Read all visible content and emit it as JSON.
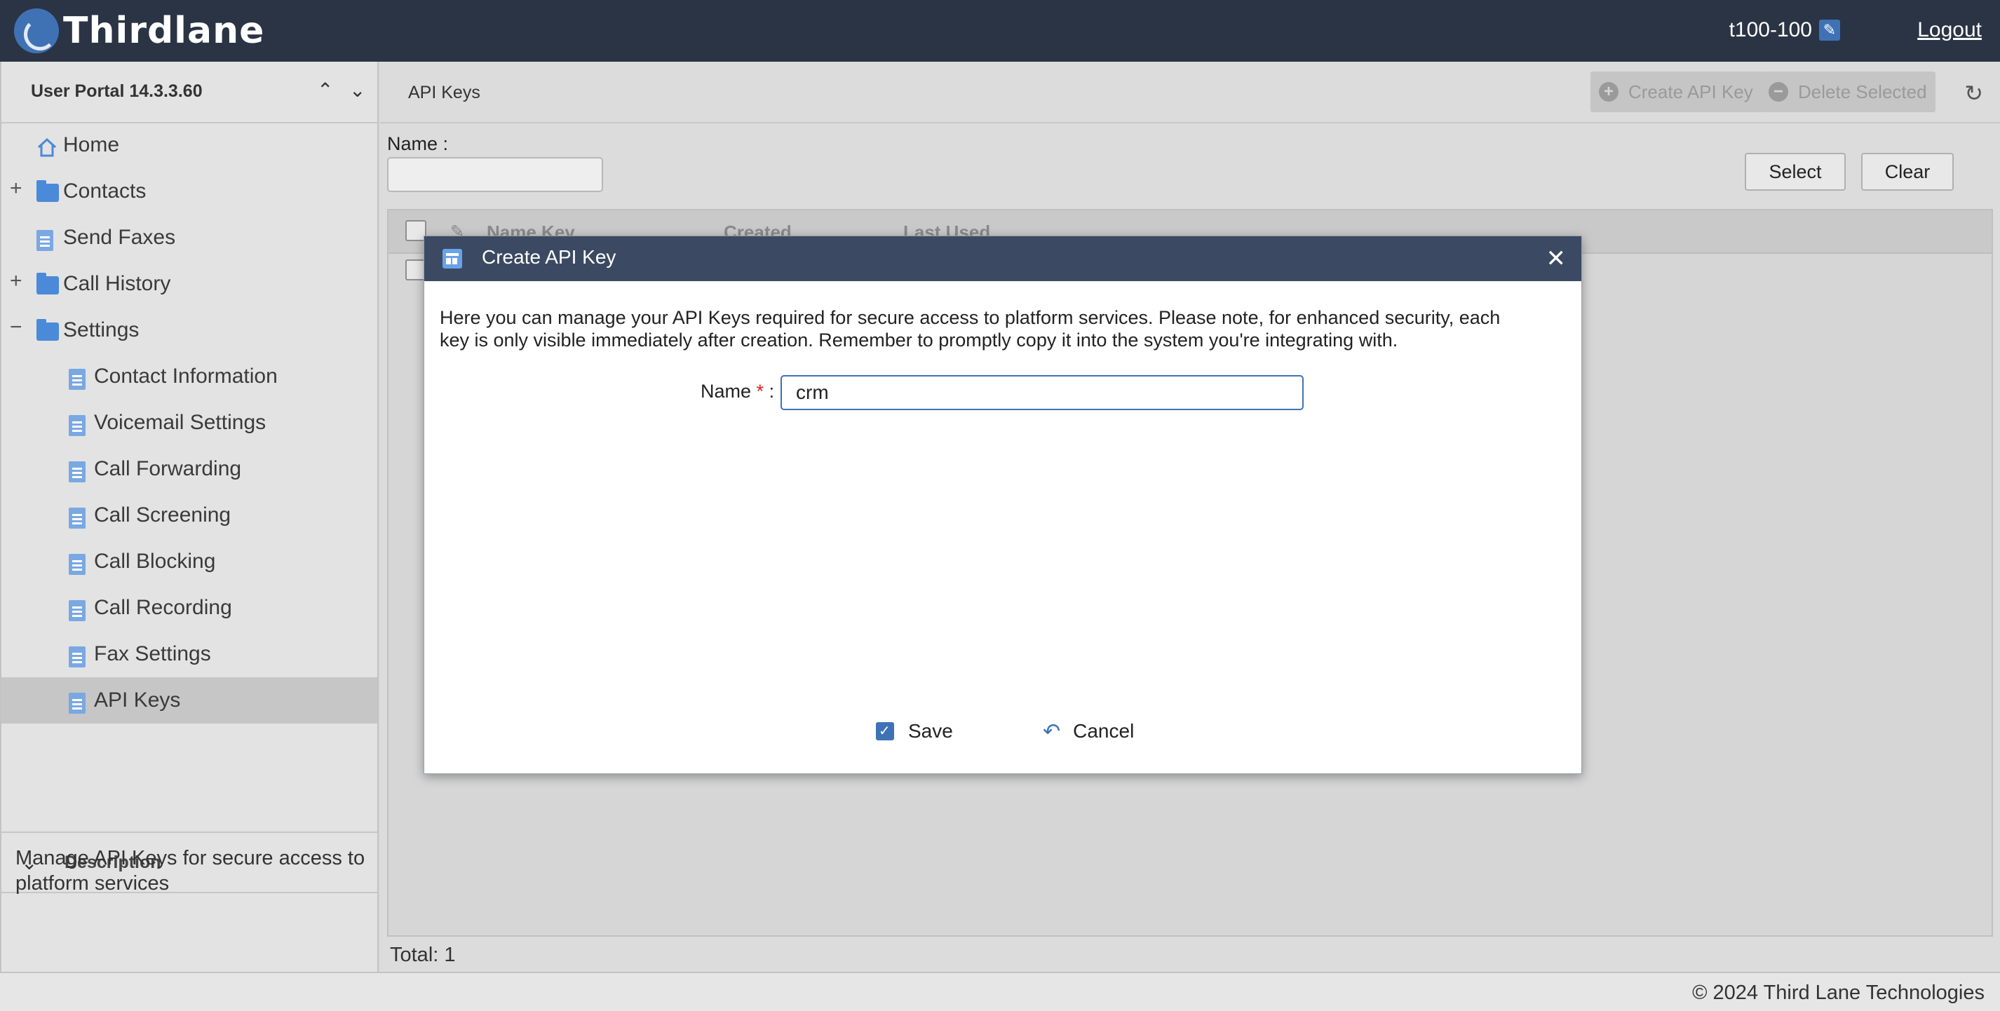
{
  "topbar": {
    "logo_text": "Thirdlane",
    "user": "t100-100",
    "logout_label": "Logout"
  },
  "sidebar": {
    "title": "User Portal 14.3.3.60",
    "items": [
      {
        "label": "Home",
        "icon": "home-icon"
      },
      {
        "label": "Contacts",
        "icon": "folder-icon",
        "toggle": "+"
      },
      {
        "label": "Send Faxes",
        "icon": "document-icon"
      },
      {
        "label": "Call History",
        "icon": "folder-icon",
        "toggle": "+"
      },
      {
        "label": "Settings",
        "icon": "folder-icon",
        "toggle": "−"
      },
      {
        "label": "Contact Information",
        "icon": "document-icon"
      },
      {
        "label": "Voicemail Settings",
        "icon": "document-icon"
      },
      {
        "label": "Call Forwarding",
        "icon": "document-icon"
      },
      {
        "label": "Call Screening",
        "icon": "document-icon"
      },
      {
        "label": "Call Blocking",
        "icon": "document-icon"
      },
      {
        "label": "Call Recording",
        "icon": "document-icon"
      },
      {
        "label": "Fax Settings",
        "icon": "document-icon"
      },
      {
        "label": "API Keys",
        "icon": "document-icon",
        "selected": true
      }
    ],
    "description_title": "Description",
    "description_text": "Manage API Keys for secure access to platform services"
  },
  "main": {
    "title": "API Keys",
    "create_label": "Create API Key",
    "delete_label": "Delete Selected",
    "filter_label": "Name :",
    "filter_value": "",
    "select_label": "Select",
    "clear_label": "Clear",
    "columns": [
      "Name Key",
      "Created",
      "Last Used"
    ],
    "total": "Total: 1"
  },
  "modal": {
    "title": "Create API Key",
    "description": "Here you can manage your API Keys required for secure access to platform services. Please note, for enhanced security, each key is only visible immediately after creation. Remember to promptly copy it into the system you're integrating with.",
    "name_label": "Name",
    "required_mark": "*",
    "name_value": "crm",
    "save_label": "Save",
    "cancel_label": "Cancel"
  },
  "footer": {
    "copyright": "© 2024 Third Lane Technologies"
  },
  "colors": {
    "topbar": "#2b3444",
    "accent": "#3f72b5",
    "modal_header": "#3b4a62"
  }
}
